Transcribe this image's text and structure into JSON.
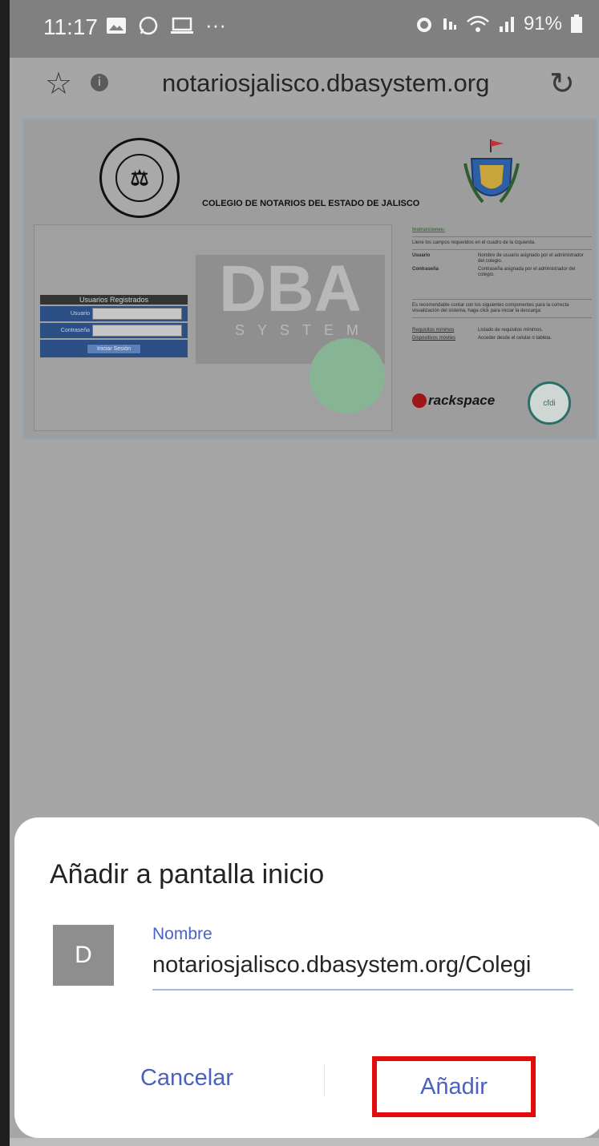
{
  "status_bar": {
    "time": "11:17",
    "battery_percent": "91%",
    "more_indicator": "···"
  },
  "browser": {
    "url": "notariosjalisco.dbasystem.org"
  },
  "website": {
    "title": "COLEGIO DE NOTARIOS DEL ESTADO DE JALISCO",
    "logo_text": "DBA",
    "logo_subtext": "SYSTEM",
    "login": {
      "header": "Usuarios Registrados",
      "user_label": "Usuario",
      "password_label": "Contraseña",
      "submit_label": "Iniciar Sesión"
    },
    "instructions": {
      "title": "Instrucciones:",
      "intro": "Llene los campos requeridos en el cuadro de la izquierda.",
      "user_term": "Usuario",
      "user_desc": "Nombre de usuario asignado por el administrador del colegio.",
      "password_term": "Contraseña",
      "password_desc": "Contraseña asignada por el administrador del colegio.",
      "recommend": "Es recomendable contar con los siguientes componentes para la correcta visualización del sistema, haga click para iniciar la descarga:",
      "link1": "Requisitos mínimos",
      "link1_desc": "Listado de requisitos mínimos.",
      "link2": "Dispositivos móviles",
      "link2_desc": "Acceder desde el celular o tableta."
    },
    "rackspace_text": "rackspace",
    "cfdi_text": "cfdi"
  },
  "dialog": {
    "title": "Añadir a pantalla inicio",
    "avatar_letter": "D",
    "name_label": "Nombre",
    "name_value": "notariosjalisco.dbasystem.org/Colegi",
    "cancel_label": "Cancelar",
    "add_label": "Añadir"
  },
  "colors": {
    "accent": "#4b61c0",
    "highlight_border": "#e60b0b",
    "dim_overlay": "#a6a6a6"
  }
}
